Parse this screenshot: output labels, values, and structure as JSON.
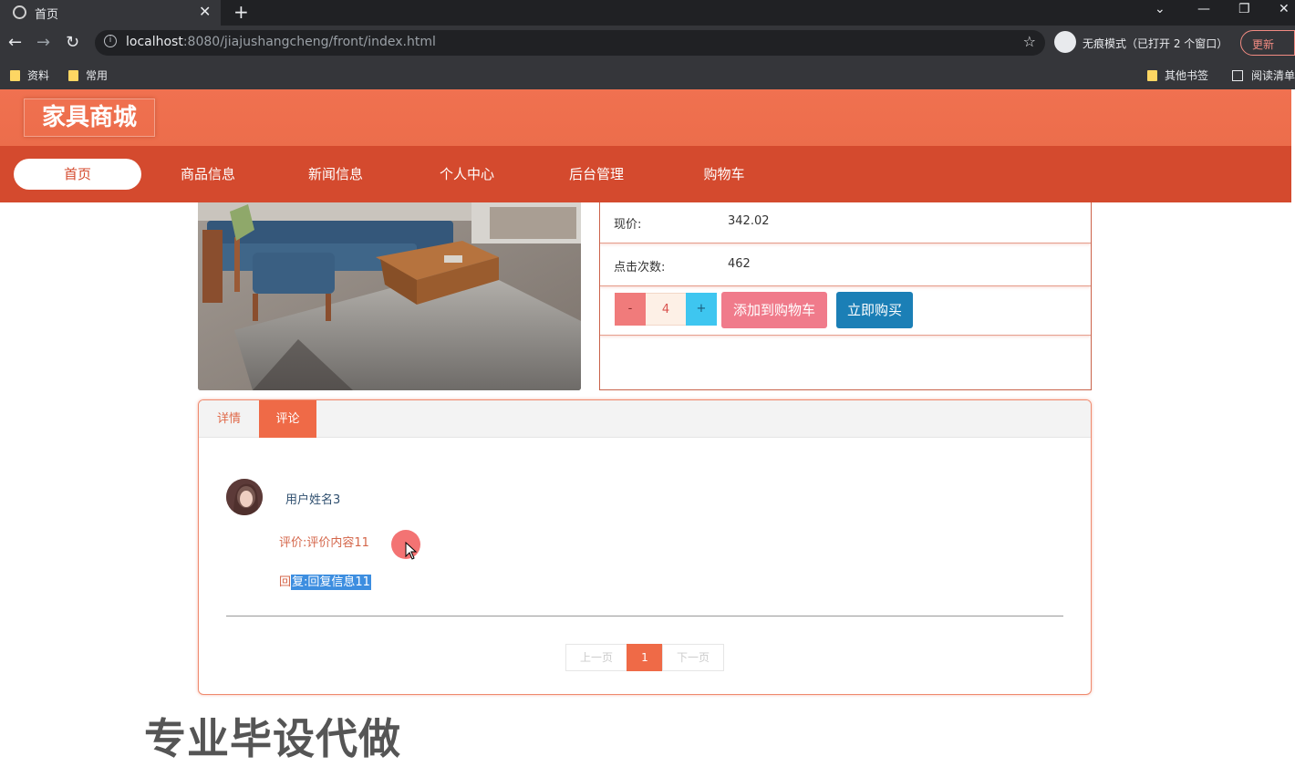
{
  "browser": {
    "tab_title": "首页",
    "url_host": "localhost",
    "url_rest": ":8080/jiajushangcheng/front/index.html",
    "incognito_label": "无痕模式（已打开 2 个窗口）",
    "update_label": "更新",
    "bookmarks": [
      "资料",
      "常用"
    ],
    "bookmarks_right": [
      "其他书签",
      "阅读清单"
    ]
  },
  "site": {
    "logo": "家具商城",
    "nav": [
      "首页",
      "商品信息",
      "新闻信息",
      "个人中心",
      "后台管理",
      "购物车"
    ],
    "active_nav": "首页"
  },
  "product": {
    "price_label": "现价:",
    "price_value": "342.02",
    "clicks_label": "点击次数:",
    "clicks_value": "462",
    "qty_minus": "-",
    "qty_value": "4",
    "qty_plus": "+",
    "add_to_cart": "添加到购物车",
    "buy_now": "立即购买"
  },
  "detail_tabs": {
    "tabs": [
      "详情",
      "评论"
    ],
    "active": "评论"
  },
  "comment": {
    "username": "用户姓名3",
    "content": "评价:评价内容11",
    "reply_prefix": "回",
    "reply_selected": "复:回复信息11"
  },
  "pagination": {
    "prev": "上一页",
    "current": "1",
    "next": "下一页"
  },
  "watermark": "专业毕设代做",
  "colors": {
    "header": "#f07150",
    "nav": "#d44a2e",
    "accent": "#ef6a47",
    "buy_now": "#1b7fb6",
    "add_cart": "#f07b8b"
  }
}
